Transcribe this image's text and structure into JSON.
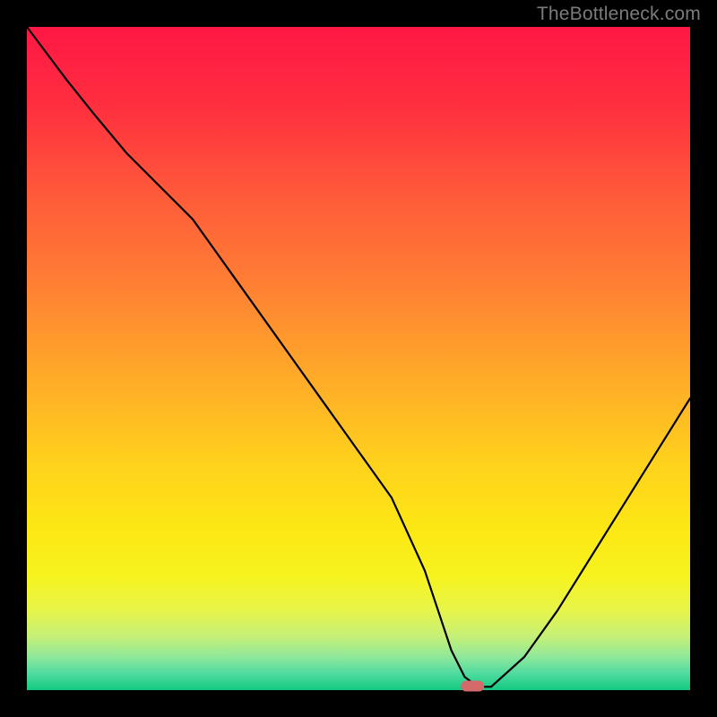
{
  "watermark": "TheBottleneck.com",
  "chart_data": {
    "type": "line",
    "title": "",
    "xlabel": "",
    "ylabel": "",
    "xlim": [
      0,
      100
    ],
    "ylim": [
      0,
      100
    ],
    "x": [
      0,
      3,
      6,
      10,
      15,
      20,
      25,
      30,
      35,
      40,
      45,
      50,
      55,
      60,
      62,
      64,
      66,
      68,
      70,
      75,
      80,
      85,
      90,
      95,
      100
    ],
    "values": [
      100,
      96,
      92,
      87,
      81,
      76,
      71,
      64,
      57,
      50,
      43,
      36,
      29,
      18,
      12,
      6,
      2,
      0.5,
      0.5,
      5,
      12,
      20,
      28,
      36,
      44
    ],
    "marker": {
      "x_fraction": 0.672,
      "y_fraction": 0.006
    },
    "gradient_bands": [
      {
        "offset": 0.0,
        "color": "#ff1745"
      },
      {
        "offset": 0.12,
        "color": "#ff2f3f"
      },
      {
        "offset": 0.25,
        "color": "#ff593a"
      },
      {
        "offset": 0.38,
        "color": "#ff7d34"
      },
      {
        "offset": 0.52,
        "color": "#ffa829"
      },
      {
        "offset": 0.66,
        "color": "#ffd21c"
      },
      {
        "offset": 0.76,
        "color": "#fce814"
      },
      {
        "offset": 0.83,
        "color": "#f6f320"
      },
      {
        "offset": 0.88,
        "color": "#e7f54a"
      },
      {
        "offset": 0.92,
        "color": "#c4f079"
      },
      {
        "offset": 0.95,
        "color": "#8fe89a"
      },
      {
        "offset": 0.975,
        "color": "#4fdba0"
      },
      {
        "offset": 1.0,
        "color": "#13c981"
      }
    ],
    "frame_color": "#000000",
    "line_color": "#000000",
    "marker_color": "#d46a6a",
    "grid": false,
    "legend": false
  }
}
